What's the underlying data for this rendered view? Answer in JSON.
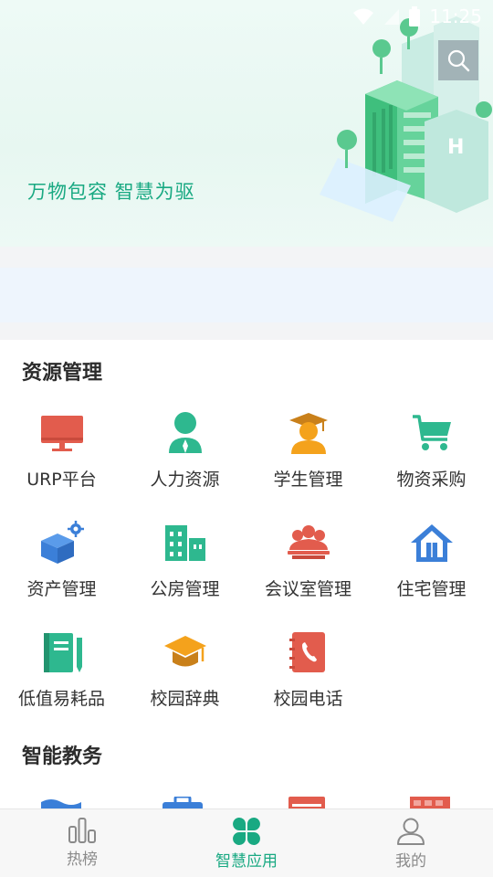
{
  "status_bar": {
    "time": "11:25"
  },
  "banner": {
    "slogan": "万物包容 智慧为驱",
    "search_icon": "search-icon"
  },
  "sections": [
    {
      "title": "资源管理",
      "items": [
        {
          "label": "URP平台",
          "icon": "monitor-icon",
          "color": "#e25c4d"
        },
        {
          "label": "人力资源",
          "icon": "person-icon",
          "color": "#2eb88f"
        },
        {
          "label": "学生管理",
          "icon": "graduate-icon",
          "color": "#f4a21c"
        },
        {
          "label": "物资采购",
          "icon": "cart-icon",
          "color": "#2eb88f"
        },
        {
          "label": "资产管理",
          "icon": "box-gear-icon",
          "color": "#3b7fd8"
        },
        {
          "label": "公房管理",
          "icon": "buildings-icon",
          "color": "#2eb88f"
        },
        {
          "label": "会议室管理",
          "icon": "meeting-icon",
          "color": "#e25c4d"
        },
        {
          "label": "住宅管理",
          "icon": "house-icon",
          "color": "#3b7fd8"
        },
        {
          "label": "低值易耗品",
          "icon": "notebook-icon",
          "color": "#2eb88f"
        },
        {
          "label": "校园辞典",
          "icon": "mortarboard-icon",
          "color": "#f4a21c"
        },
        {
          "label": "校园电话",
          "icon": "phone-book-icon",
          "color": "#e25c4d"
        }
      ]
    },
    {
      "title": "智能教务"
    }
  ],
  "bottom_nav": [
    {
      "label": "热榜",
      "icon": "bar-chart-icon",
      "active": false
    },
    {
      "label": "智慧应用",
      "icon": "clover-icon",
      "active": true
    },
    {
      "label": "我的",
      "icon": "user-icon",
      "active": false
    }
  ],
  "colors": {
    "accent": "#19a982",
    "inactive": "#8a8a8a"
  }
}
